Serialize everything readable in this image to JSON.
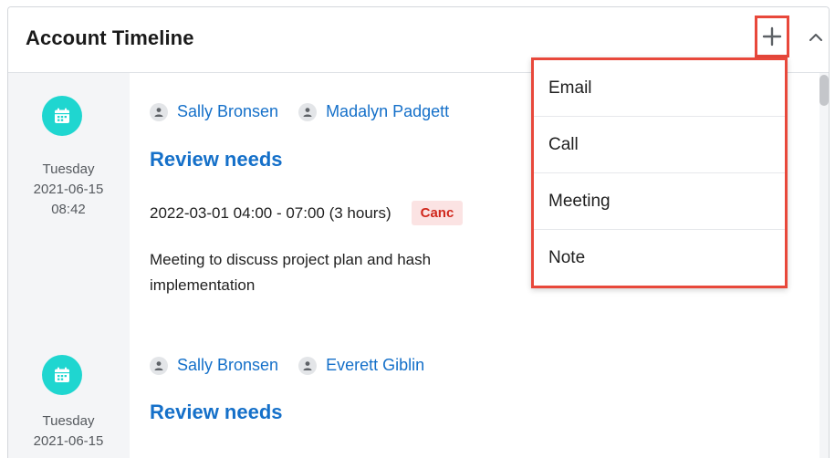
{
  "header": {
    "title": "Account Timeline",
    "add_icon": "plus-icon",
    "collapse_icon": "chevron-up-icon"
  },
  "entries": [
    {
      "icon": "calendar-icon",
      "date": {
        "day": "Tuesday",
        "date": "2021-06-15",
        "time": "08:42"
      },
      "people": [
        "Sally Bronsen",
        "Madalyn Padgett"
      ],
      "title": "Review needs",
      "time_range": "2022-03-01 04:00 - 07:00 (3 hours)",
      "status": "Canc",
      "description": "Meeting to discuss project plan and hash",
      "description_cont": "implementation"
    },
    {
      "icon": "calendar-icon",
      "date": {
        "day": "Tuesday",
        "date": "2021-06-15"
      },
      "people": [
        "Sally Bronsen",
        "Everett Giblin"
      ],
      "title": "Review needs"
    }
  ],
  "add_menu": {
    "items": [
      "Email",
      "Call",
      "Meeting",
      "Note"
    ]
  },
  "colors": {
    "accent_blue": "#1570c9",
    "badge_teal": "#1fd6d0",
    "highlight_red": "#e8483b",
    "status_red": "#d0281d"
  }
}
